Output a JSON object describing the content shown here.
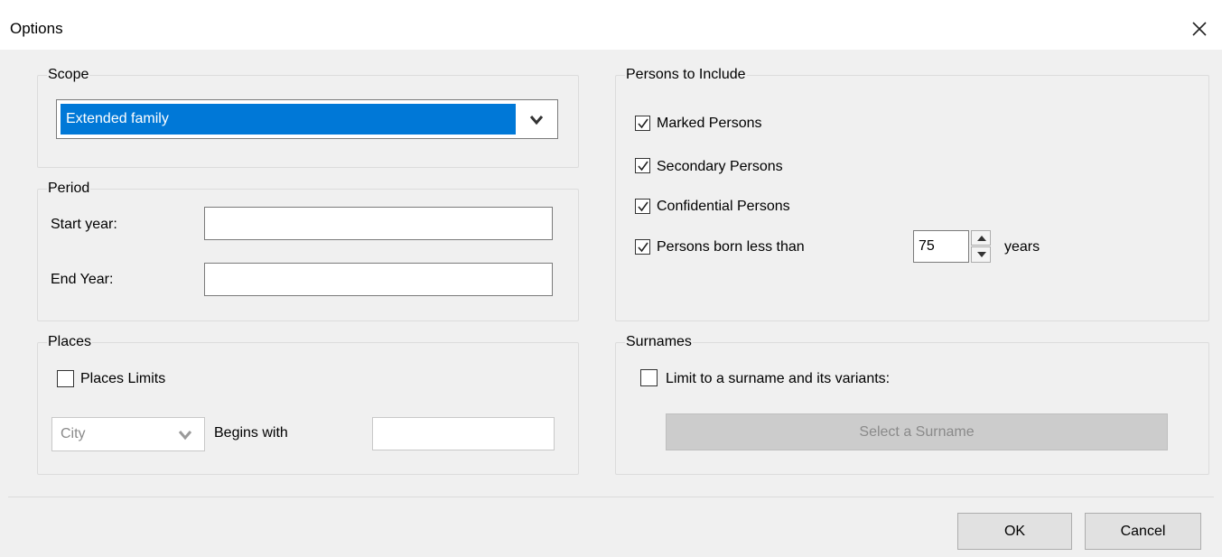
{
  "window": {
    "title": "Options"
  },
  "scope": {
    "legend": "Scope",
    "selected": "Extended family"
  },
  "period": {
    "legend": "Period",
    "start_label": "Start year:",
    "start_value": "",
    "end_label": "End Year:",
    "end_value": ""
  },
  "places": {
    "legend": "Places",
    "limits_label": "Places Limits",
    "limits_checked": false,
    "type_selected": "City",
    "begins_label": "Begins with",
    "begins_value": ""
  },
  "persons": {
    "legend": "Persons to Include",
    "marked_label": "Marked Persons",
    "marked_checked": true,
    "secondary_label": "Secondary Persons",
    "secondary_checked": true,
    "confidential_label": "Confidential Persons",
    "confidential_checked": true,
    "born_label": "Persons born less than",
    "born_checked": true,
    "born_years_value": "75",
    "years_label": "years"
  },
  "surnames": {
    "legend": "Surnames",
    "limit_label": "Limit to a surname and its variants:",
    "limit_checked": false,
    "select_button": "Select a Surname"
  },
  "buttons": {
    "ok": "OK",
    "cancel": "Cancel"
  },
  "icons": {
    "close": "close-icon",
    "dropdown": "chevron-down-icon",
    "check": "checkmark-icon",
    "spin_up": "spin-up-icon",
    "spin_down": "spin-down-icon"
  },
  "colors": {
    "selection": "#0078d7",
    "dialog_bg": "#f0f0f0",
    "button_bg": "#e1e1e1",
    "disabled_text": "#8a8a8a"
  }
}
